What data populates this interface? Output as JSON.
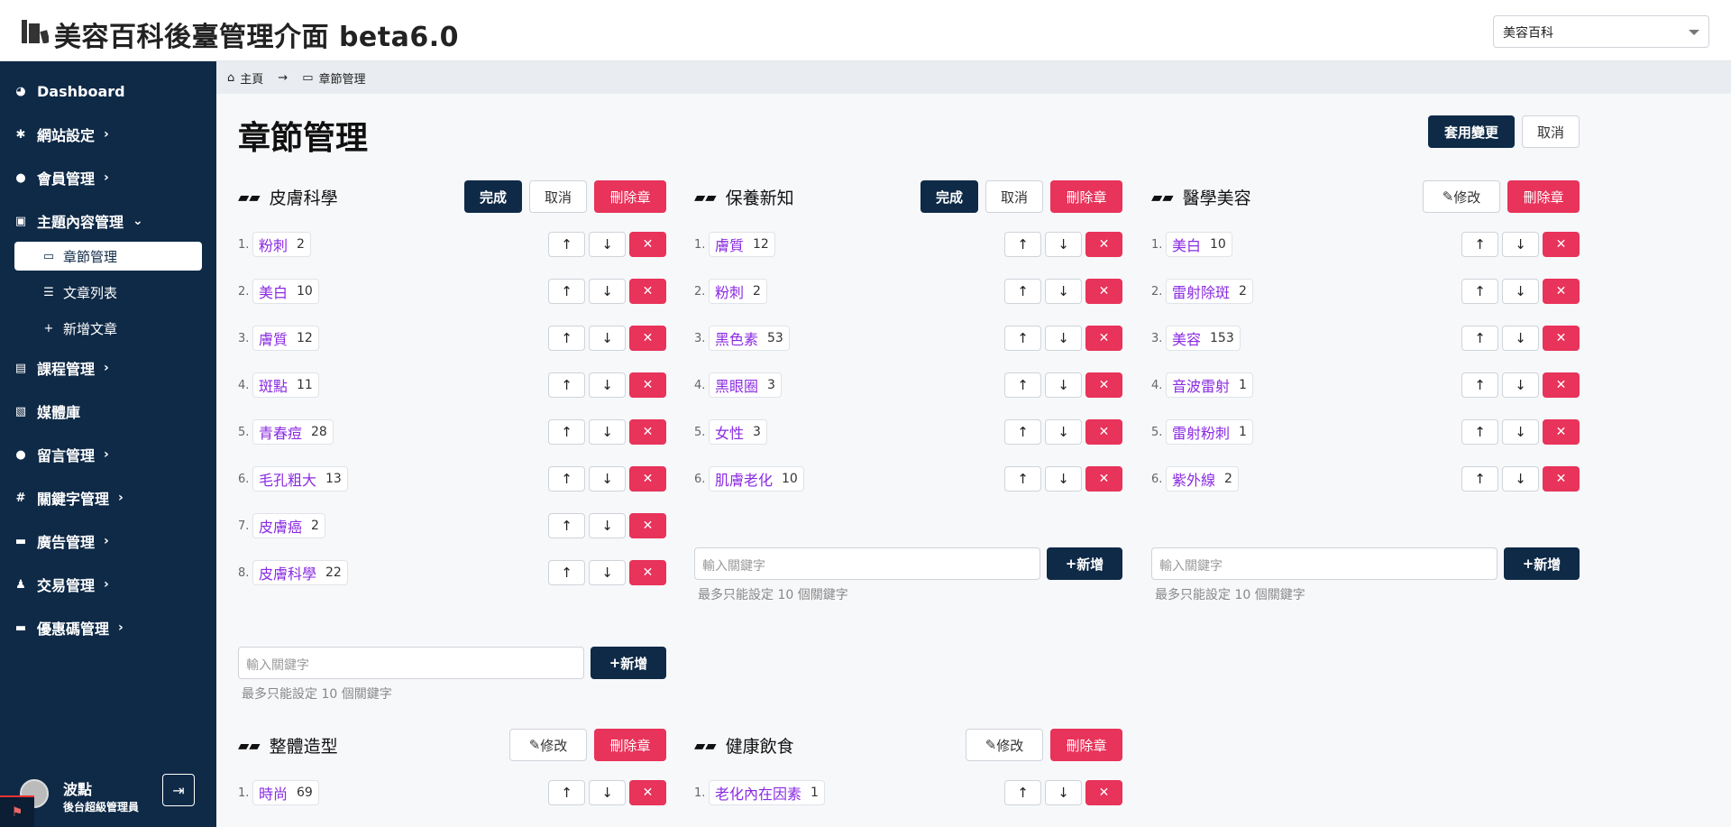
{
  "header": {
    "title": "美容百科後臺管理介面 beta6.0",
    "site_select": "美容百科"
  },
  "sidebar": {
    "items": [
      {
        "label": "Dashboard",
        "icon": "palette-icon"
      },
      {
        "label": "網站設定",
        "icon": "gear-icon"
      },
      {
        "label": "會員管理",
        "icon": "users-icon"
      },
      {
        "label": "主題內容管理",
        "icon": "box-icon"
      },
      {
        "label": "章節管理",
        "icon": "drive-icon"
      },
      {
        "label": "文章列表",
        "icon": "list-icon"
      },
      {
        "label": "新增文章",
        "icon": "plus-icon"
      },
      {
        "label": "課程管理",
        "icon": "book-icon"
      },
      {
        "label": "媒體庫",
        "icon": "photo-icon"
      },
      {
        "label": "留言管理",
        "icon": "comment-icon"
      },
      {
        "label": "關鍵字管理",
        "icon": "hashtag-icon"
      },
      {
        "label": "廣告管理",
        "icon": "ad-icon"
      },
      {
        "label": "交易管理",
        "icon": "money-icon"
      },
      {
        "label": "優惠碼管理",
        "icon": "ticket-icon"
      }
    ],
    "user": {
      "name": "波點",
      "role": "後台超級管理員"
    }
  },
  "breadcrumb": {
    "home": "主頁",
    "current": "章節管理"
  },
  "page": {
    "title": "章節管理",
    "apply_label": "套用變更",
    "cancel_label": "取消"
  },
  "labels": {
    "done": "完成",
    "cancel": "取消",
    "delete_chapter": "刪除章",
    "edit": "修改",
    "add": "新增",
    "input_placeholder": "輸入關鍵字",
    "hint": "最多只能設定 10 個關鍵字"
  },
  "chapters": [
    {
      "title": "皮膚科學",
      "keywords": [
        {
          "name": "粉刺",
          "count": "2"
        },
        {
          "name": "美白",
          "count": "10"
        },
        {
          "name": "膚質",
          "count": "12"
        },
        {
          "name": "斑點",
          "count": "11"
        },
        {
          "name": "青春痘",
          "count": "28"
        },
        {
          "name": "毛孔粗大",
          "count": "13"
        },
        {
          "name": "皮膚癌",
          "count": "2"
        },
        {
          "name": "皮膚科學",
          "count": "22"
        }
      ]
    },
    {
      "title": "保養新知",
      "keywords": [
        {
          "name": "膚質",
          "count": "12"
        },
        {
          "name": "粉刺",
          "count": "2"
        },
        {
          "name": "黑色素",
          "count": "53"
        },
        {
          "name": "黑眼圈",
          "count": "3"
        },
        {
          "name": "女性",
          "count": "3"
        },
        {
          "name": "肌膚老化",
          "count": "10"
        }
      ]
    },
    {
      "title": "醫學美容",
      "keywords": [
        {
          "name": "美白",
          "count": "10"
        },
        {
          "name": "雷射除斑",
          "count": "2"
        },
        {
          "name": "美容",
          "count": "153"
        },
        {
          "name": "音波雷射",
          "count": "1"
        },
        {
          "name": "雷射粉刺",
          "count": "1"
        },
        {
          "name": "紫外線",
          "count": "2"
        }
      ]
    },
    {
      "title": "整體造型",
      "keywords": [
        {
          "name": "時尚",
          "count": "69"
        }
      ]
    },
    {
      "title": "健康飲食",
      "keywords": [
        {
          "name": "老化內在因素",
          "count": "1"
        }
      ]
    }
  ]
}
